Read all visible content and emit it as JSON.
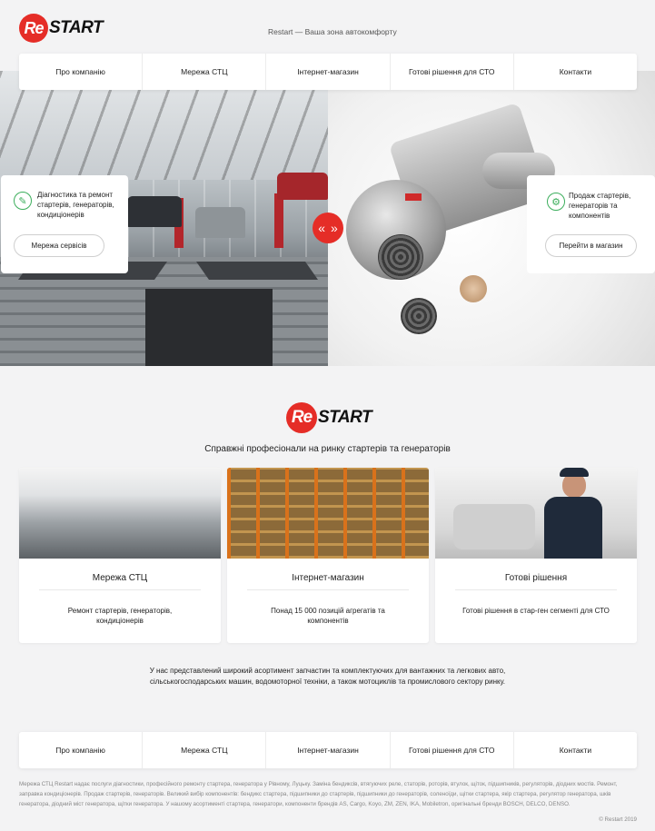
{
  "brand": {
    "logo_prefix": "Re",
    "logo_word": "START"
  },
  "header": {
    "tagline": "Restart — Ваша зона автокомфорту"
  },
  "nav": {
    "items": [
      {
        "label": "Про компанію"
      },
      {
        "label": "Мережа СТЦ"
      },
      {
        "label": "Інтернет-магазин"
      },
      {
        "label": "Готові рішення для СТО"
      },
      {
        "label": "Контакти"
      }
    ]
  },
  "hero": {
    "left_card": {
      "icon": "wrench-icon",
      "text": "Діагностика та ремонт стартерів, генераторів, кондиціонерів",
      "button": "Мережа сервісів"
    },
    "right_card": {
      "icon": "gear-icon",
      "text": "Продаж стартерів, генераторів та компонентів",
      "button": "Перейти в магазин"
    },
    "slider_prev": "«",
    "slider_next": "»"
  },
  "intro": {
    "slogan": "Справжні професіонали на ринку стартерів та генераторів"
  },
  "features": [
    {
      "title": "Мережа СТЦ",
      "desc": "Ремонт стартерів, генераторів, кондиціонерів"
    },
    {
      "title": "Інтернет-магазин",
      "desc": "Понад 15 000 позицій агрегатів та компонентів"
    },
    {
      "title": "Готові рішення",
      "desc": "Готові рішення в стар-ген сегменті для СТО"
    }
  ],
  "assortment": "У нас представлений широкий асортимент запчастин та комплектуючих для вантажних та легкових авто, сільськогосподарських машин, водомоторної техніки, а також мотоциклів та промислового сектору ринку.",
  "footer": {
    "text": "Мережа СТЦ Restart надає послуги діагностики, професійного ремонту стартера, генератора у Рівному, Луцьку. Заміна бендиксів, втягуючих реле, статорів, роторів, втулок, щіток, підшипників, регуляторів, діодних мостів. Ремонт, заправка кондиціонерів. Продаж стартерів, генераторів. Великий вибір компонентів: бендикс стартера, підшипники до стартерів, підшипники до генераторів, соленоїди, щітки стартера, якір стартера, регулятор генератора, шків генератора, діодний міст генератора, щітки генератора. У нашому асортименті стартера, генератори, компоненти брендів AS, Cargo, Koyo, ZM, ZEN, IKA, Mobiletron, оригінальні бренди BOSCH, DELCO, DENSO.",
    "copyright": "© Restart 2019"
  },
  "colors": {
    "accent": "#e52d27",
    "icon_green": "#3cae5c",
    "background": "#f3f3f4"
  }
}
